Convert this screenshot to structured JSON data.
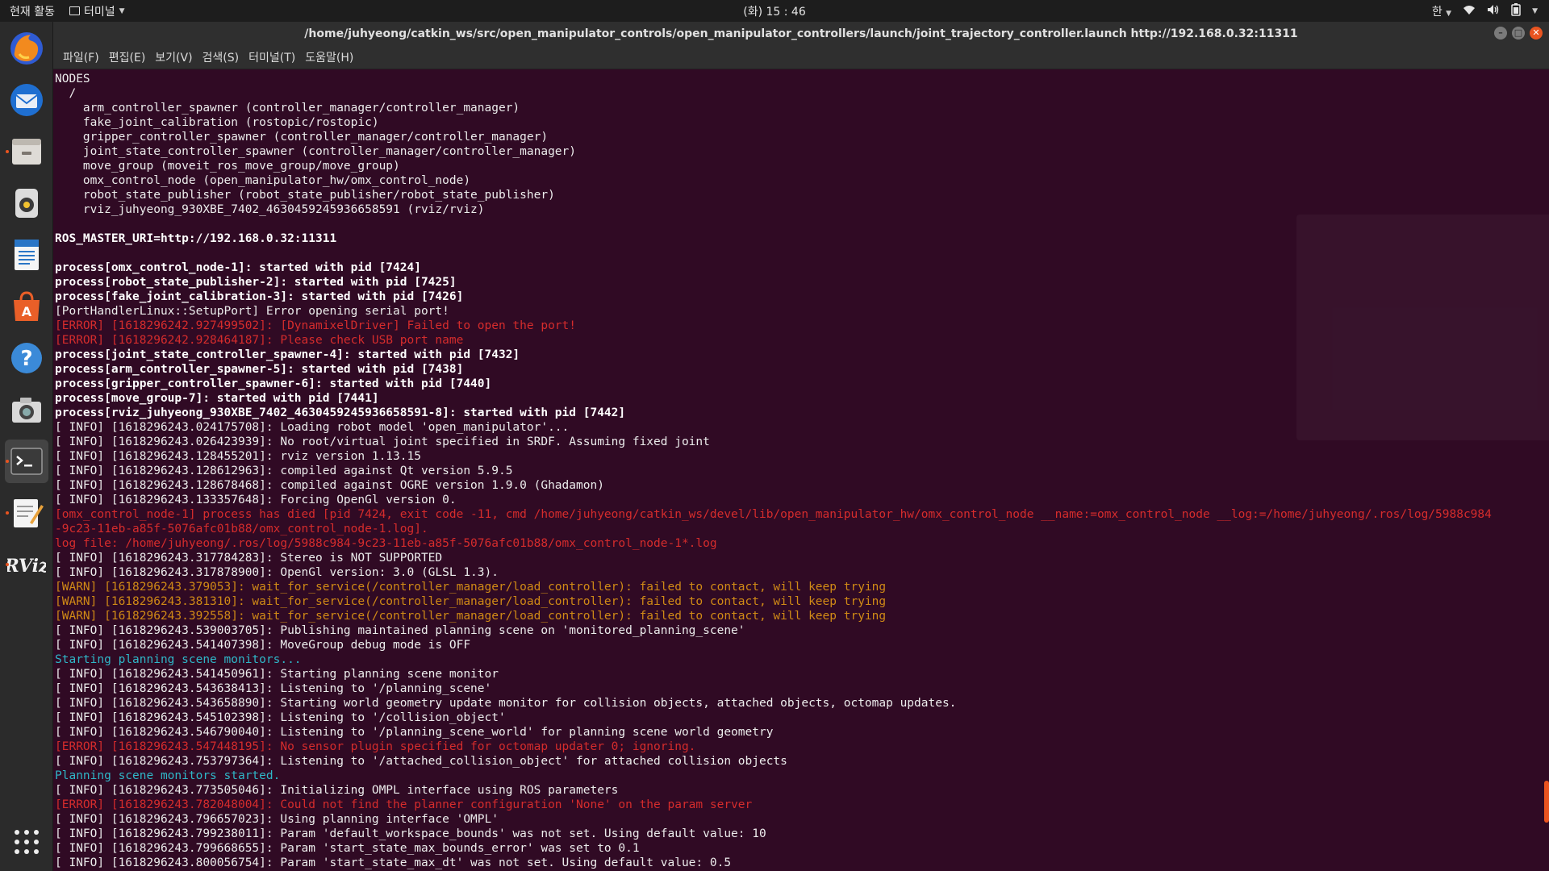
{
  "system_bar": {
    "activities": "현재 활동",
    "app_name": "터미널",
    "clock": "(화) 15 : 46",
    "input_method": "한"
  },
  "dock": {
    "items": [
      {
        "name": "firefox-icon",
        "glyph": "🦊"
      },
      {
        "name": "thunderbird-icon",
        "glyph": "✉"
      },
      {
        "name": "files-icon",
        "glyph": "🗄"
      },
      {
        "name": "rhythmbox-icon",
        "glyph": "◉"
      },
      {
        "name": "writer-icon",
        "glyph": "📄"
      },
      {
        "name": "software-center-icon",
        "glyph": "A"
      },
      {
        "name": "help-icon",
        "glyph": "?"
      },
      {
        "name": "camera-icon",
        "glyph": "📷"
      },
      {
        "name": "terminal-icon",
        "glyph": ">_"
      },
      {
        "name": "text-editor-icon",
        "glyph": "✎"
      },
      {
        "name": "rviz-icon",
        "glyph": "RViz"
      },
      {
        "name": "app-grid-icon",
        "glyph": "⋮⋮⋮"
      }
    ]
  },
  "window": {
    "title": "/home/juhyeong/catkin_ws/src/open_manipulator_controls/open_manipulator_controllers/launch/joint_trajectory_controller.launch http://192.168.0.32:11311",
    "menu": [
      "파일(F)",
      "편집(E)",
      "보기(V)",
      "검색(S)",
      "터미널(T)",
      "도움말(H)"
    ]
  },
  "terminal": {
    "lines": [
      {
        "t": "NODES",
        "s": "normal"
      },
      {
        "t": "  /",
        "s": "normal"
      },
      {
        "t": "    arm_controller_spawner (controller_manager/controller_manager)",
        "s": "normal"
      },
      {
        "t": "    fake_joint_calibration (rostopic/rostopic)",
        "s": "normal"
      },
      {
        "t": "    gripper_controller_spawner (controller_manager/controller_manager)",
        "s": "normal"
      },
      {
        "t": "    joint_state_controller_spawner (controller_manager/controller_manager)",
        "s": "normal"
      },
      {
        "t": "    move_group (moveit_ros_move_group/move_group)",
        "s": "normal"
      },
      {
        "t": "    omx_control_node (open_manipulator_hw/omx_control_node)",
        "s": "normal"
      },
      {
        "t": "    robot_state_publisher (robot_state_publisher/robot_state_publisher)",
        "s": "normal"
      },
      {
        "t": "    rviz_juhyeong_930XBE_7402_4630459245936658591 (rviz/rviz)",
        "s": "normal"
      },
      {
        "t": "",
        "s": "normal"
      },
      {
        "t": "ROS_MASTER_URI=http://192.168.0.32:11311",
        "s": "bold"
      },
      {
        "t": "",
        "s": "normal"
      },
      {
        "t": "process[omx_control_node-1]: started with pid [7424]",
        "s": "bold"
      },
      {
        "t": "process[robot_state_publisher-2]: started with pid [7425]",
        "s": "bold"
      },
      {
        "t": "process[fake_joint_calibration-3]: started with pid [7426]",
        "s": "bold"
      },
      {
        "t": "[PortHandlerLinux::SetupPort] Error opening serial port!",
        "s": "normal"
      },
      {
        "t": "[ERROR] [1618296242.927499502]: [DynamixelDriver] Failed to open the port!",
        "s": "err"
      },
      {
        "t": "[ERROR] [1618296242.928464187]: Please check USB port name",
        "s": "err"
      },
      {
        "t": "process[joint_state_controller_spawner-4]: started with pid [7432]",
        "s": "bold"
      },
      {
        "t": "process[arm_controller_spawner-5]: started with pid [7438]",
        "s": "bold"
      },
      {
        "t": "process[gripper_controller_spawner-6]: started with pid [7440]",
        "s": "bold"
      },
      {
        "t": "process[move_group-7]: started with pid [7441]",
        "s": "bold"
      },
      {
        "t": "process[rviz_juhyeong_930XBE_7402_4630459245936658591-8]: started with pid [7442]",
        "s": "bold"
      },
      {
        "t": "[ INFO] [1618296243.024175708]: Loading robot model 'open_manipulator'...",
        "s": "normal"
      },
      {
        "t": "[ INFO] [1618296243.026423939]: No root/virtual joint specified in SRDF. Assuming fixed joint",
        "s": "normal"
      },
      {
        "t": "[ INFO] [1618296243.128455201]: rviz version 1.13.15",
        "s": "normal"
      },
      {
        "t": "[ INFO] [1618296243.128612963]: compiled against Qt version 5.9.5",
        "s": "normal"
      },
      {
        "t": "[ INFO] [1618296243.128678468]: compiled against OGRE version 1.9.0 (Ghadamon)",
        "s": "normal"
      },
      {
        "t": "[ INFO] [1618296243.133357648]: Forcing OpenGl version 0.",
        "s": "normal"
      },
      {
        "t": "[omx_control_node-1] process has died [pid 7424, exit code -11, cmd /home/juhyeong/catkin_ws/devel/lib/open_manipulator_hw/omx_control_node __name:=omx_control_node __log:=/home/juhyeong/.ros/log/5988c984",
        "s": "err"
      },
      {
        "t": "-9c23-11eb-a85f-5076afc01b88/omx_control_node-1.log].",
        "s": "err"
      },
      {
        "t": "log file: /home/juhyeong/.ros/log/5988c984-9c23-11eb-a85f-5076afc01b88/omx_control_node-1*.log",
        "s": "err"
      },
      {
        "t": "[ INFO] [1618296243.317784283]: Stereo is NOT SUPPORTED",
        "s": "normal"
      },
      {
        "t": "[ INFO] [1618296243.317878900]: OpenGl version: 3.0 (GLSL 1.3).",
        "s": "normal"
      },
      {
        "t": "[WARN] [1618296243.379053]: wait_for_service(/controller_manager/load_controller): failed to contact, will keep trying",
        "s": "warn"
      },
      {
        "t": "[WARN] [1618296243.381310]: wait_for_service(/controller_manager/load_controller): failed to contact, will keep trying",
        "s": "warn"
      },
      {
        "t": "[WARN] [1618296243.392558]: wait_for_service(/controller_manager/load_controller): failed to contact, will keep trying",
        "s": "warn"
      },
      {
        "t": "[ INFO] [1618296243.539003705]: Publishing maintained planning scene on 'monitored_planning_scene'",
        "s": "normal"
      },
      {
        "t": "[ INFO] [1618296243.541407398]: MoveGroup debug mode is OFF",
        "s": "normal"
      },
      {
        "t": "Starting planning scene monitors...",
        "s": "cyan"
      },
      {
        "t": "[ INFO] [1618296243.541450961]: Starting planning scene monitor",
        "s": "normal"
      },
      {
        "t": "[ INFO] [1618296243.543638413]: Listening to '/planning_scene'",
        "s": "normal"
      },
      {
        "t": "[ INFO] [1618296243.543658890]: Starting world geometry update monitor for collision objects, attached objects, octomap updates.",
        "s": "normal"
      },
      {
        "t": "[ INFO] [1618296243.545102398]: Listening to '/collision_object'",
        "s": "normal"
      },
      {
        "t": "[ INFO] [1618296243.546790040]: Listening to '/planning_scene_world' for planning scene world geometry",
        "s": "normal"
      },
      {
        "t": "[ERROR] [1618296243.547448195]: No sensor plugin specified for octomap updater 0; ignoring.",
        "s": "err"
      },
      {
        "t": "[ INFO] [1618296243.753797364]: Listening to '/attached_collision_object' for attached collision objects",
        "s": "normal"
      },
      {
        "t": "Planning scene monitors started.",
        "s": "cyan"
      },
      {
        "t": "[ INFO] [1618296243.773505046]: Initializing OMPL interface using ROS parameters",
        "s": "normal"
      },
      {
        "t": "[ERROR] [1618296243.782048004]: Could not find the planner configuration 'None' on the param server",
        "s": "err"
      },
      {
        "t": "[ INFO] [1618296243.796657023]: Using planning interface 'OMPL'",
        "s": "normal"
      },
      {
        "t": "[ INFO] [1618296243.799238011]: Param 'default_workspace_bounds' was not set. Using default value: 10",
        "s": "normal"
      },
      {
        "t": "[ INFO] [1618296243.799668655]: Param 'start_state_max_bounds_error' was set to 0.1",
        "s": "normal"
      },
      {
        "t": "[ INFO] [1618296243.800056754]: Param 'start_state_max_dt' was not set. Using default value: 0.5",
        "s": "normal"
      }
    ]
  }
}
